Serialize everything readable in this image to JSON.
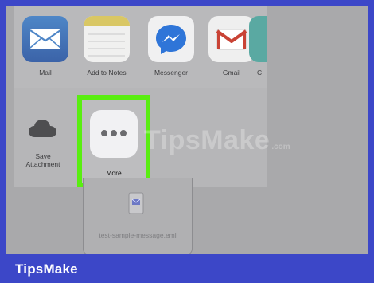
{
  "share_sheet": {
    "apps": [
      {
        "label": "Mail",
        "icon": "mail-icon",
        "color": "#4a79bf"
      },
      {
        "label": "Add to Notes",
        "icon": "notes-icon",
        "color": "#d9c764"
      },
      {
        "label": "Messenger",
        "icon": "messenger-icon",
        "color": "#2f75d8"
      },
      {
        "label": "Gmail",
        "icon": "gmail-icon",
        "color": "#c94335"
      },
      {
        "label": "C",
        "icon": "partial-app-icon",
        "color": "#5aa9a2"
      }
    ],
    "actions": [
      {
        "label_line1": "Save",
        "label_line2": "Attachment",
        "icon": "cloud-icon"
      },
      {
        "label": "More",
        "icon": "more-dots-icon",
        "highlight_color": "#59ee11"
      }
    ]
  },
  "attachment": {
    "file_name": "test-sample-message.eml",
    "icon": "email-file-icon"
  },
  "watermark": {
    "main": "TipsMake",
    "suffix": ".com"
  },
  "footer": {
    "brand": "TipsMake",
    "background": "#3c47c8"
  }
}
